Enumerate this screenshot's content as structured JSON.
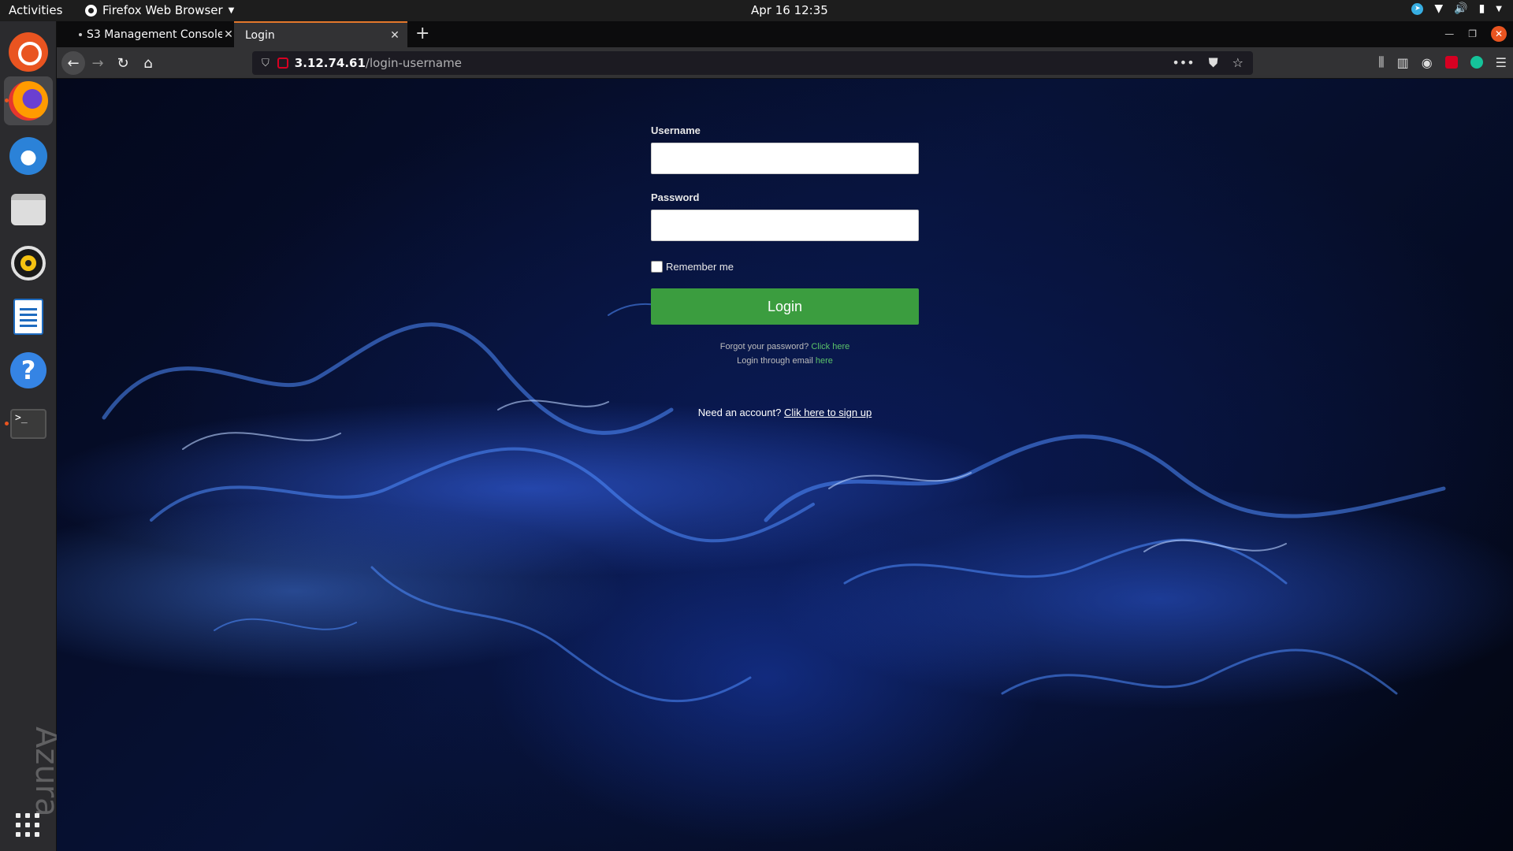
{
  "topbar": {
    "activities": "Activities",
    "app_name": "Firefox Web Browser",
    "clock": "Apr 16  12:35"
  },
  "dock": {
    "watermark": "Azura"
  },
  "browser": {
    "tabs": [
      {
        "label": "S3 Management Console",
        "active": false
      },
      {
        "label": "Login",
        "active": true
      }
    ],
    "url_host": "3.12.74.61",
    "url_path": "/login-username"
  },
  "login": {
    "username_label": "Username",
    "username_value": "",
    "password_label": "Password",
    "password_value": "",
    "remember_label": "Remember me",
    "remember_checked": false,
    "login_button": "Login",
    "forgot_text": "Forgot your password?",
    "forgot_link": "Click here",
    "email_text": "Login through email",
    "email_link": "here",
    "signup_text": "Need an account?",
    "signup_link": "Clik here to sign up"
  },
  "colors": {
    "login_button": "#3b9d3f",
    "link_green": "#5cc36a",
    "ubuntu_orange": "#e95420"
  },
  "icons": [
    "ubuntu-icon",
    "firefox-icon",
    "thunderbird-icon",
    "files-icon",
    "rhythmbox-icon",
    "writer-icon",
    "help-icon",
    "terminal-icon",
    "show-apps-icon"
  ]
}
